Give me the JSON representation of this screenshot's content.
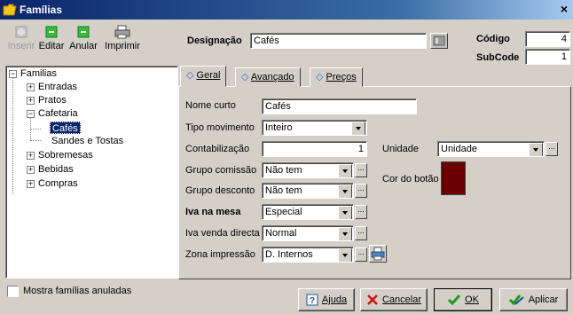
{
  "window": {
    "title": "Famílias",
    "close_glyph": "×"
  },
  "toolbar": {
    "insert": "Inserir",
    "edit": "Editar",
    "cancel": "Anular",
    "print": "Imprimir"
  },
  "tree": {
    "items": [
      {
        "label": "Familias",
        "expander": "−"
      },
      {
        "label": "Entradas",
        "expander": "+"
      },
      {
        "label": "Pratos",
        "expander": "+"
      },
      {
        "label": "Cafetaria",
        "expander": "−"
      },
      {
        "label": "Cafés",
        "selected": true
      },
      {
        "label": "Sandes e Tostas"
      },
      {
        "label": "Sobremesas",
        "expander": "+"
      },
      {
        "label": "Bebidas",
        "expander": "+"
      },
      {
        "label": "Compras",
        "expander": "+"
      }
    ]
  },
  "show_cancelled": {
    "label": "Mostra famílias anuladas",
    "checked": false
  },
  "header": {
    "designacao_label": "Designação",
    "designacao_value": "Cafés",
    "codigo_label": "Código",
    "codigo_value": "4",
    "subcode_label": "SubCode",
    "subcode_value": "1"
  },
  "tabs": [
    {
      "label": "Geral",
      "active": true
    },
    {
      "label": "Avançado",
      "active": false
    },
    {
      "label": "Preços",
      "active": false
    }
  ],
  "form": {
    "nome_curto_label": "Nome curto",
    "nome_curto_value": "Cafés",
    "tipo_movimento_label": "Tipo movimento",
    "tipo_movimento_value": "Inteiro",
    "contabilizacao_label": "Contabilização",
    "contabilizacao_value": "1",
    "grupo_comissao_label": "Grupo comissão",
    "grupo_comissao_value": "Não tem",
    "grupo_desconto_label": "Grupo desconto",
    "grupo_desconto_value": "Não tem",
    "iva_mesa_label": "Iva na mesa",
    "iva_mesa_value": "Especial",
    "iva_venda_label": "Iva venda directa",
    "iva_venda_value": "Normal",
    "zona_label": "Zona impressão",
    "zona_value": "D. Internos",
    "unidade_label": "Unidade",
    "unidade_value": "Unidade",
    "cor_label": "Cor do botão",
    "cor_value": "#6b0000",
    "ellipsis": "..."
  },
  "buttons": {
    "help": "Ajuda",
    "cancel": "Cancelar",
    "ok": "OK",
    "apply": "Aplicar"
  }
}
